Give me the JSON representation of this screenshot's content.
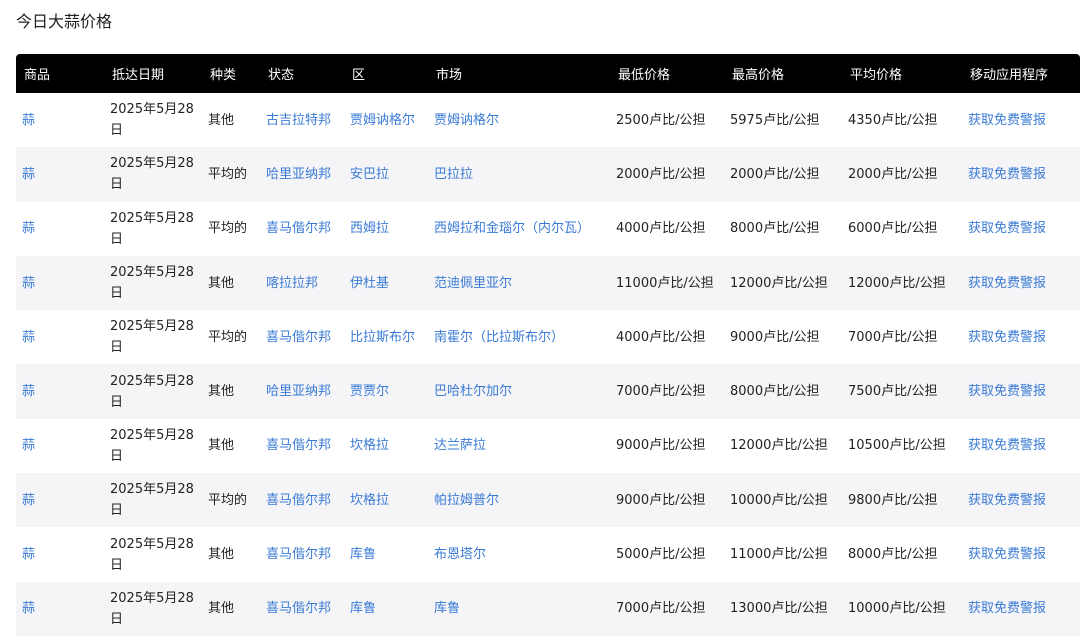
{
  "page": {
    "title": "今日大蒜价格"
  },
  "table": {
    "headers": [
      "商品",
      "抵达日期",
      "种类",
      "状态",
      "区",
      "市场",
      "最低价格",
      "最高价格",
      "平均价格",
      "移动应用程序"
    ],
    "rows": [
      {
        "product": "蒜",
        "date": "2025年5月28日",
        "variety": "其他",
        "state": "古吉拉特邦",
        "district": "贾姆讷格尔",
        "market": "贾姆讷格尔",
        "min": "2500卢比/公担",
        "max": "5975卢比/公担",
        "avg": "4350卢比/公担",
        "app": "获取免费警报"
      },
      {
        "product": "蒜",
        "date": "2025年5月28日",
        "variety": "平均的",
        "state": "哈里亚纳邦",
        "district": "安巴拉",
        "market": "巴拉拉",
        "min": "2000卢比/公担",
        "max": "2000卢比/公担",
        "avg": "2000卢比/公担",
        "app": "获取免费警报"
      },
      {
        "product": "蒜",
        "date": "2025年5月28日",
        "variety": "平均的",
        "state": "喜马偕尔邦",
        "district": "西姆拉",
        "market": "西姆拉和金瑙尔（内尔瓦）",
        "min": "4000卢比/公担",
        "max": "8000卢比/公担",
        "avg": "6000卢比/公担",
        "app": "获取免费警报"
      },
      {
        "product": "蒜",
        "date": "2025年5月28日",
        "variety": "其他",
        "state": "喀拉拉邦",
        "district": "伊杜基",
        "market": "范迪佩里亚尔",
        "min": "11000卢比/公担",
        "max": "12000卢比/公担",
        "avg": "12000卢比/公担",
        "app": "获取免费警报"
      },
      {
        "product": "蒜",
        "date": "2025年5月28日",
        "variety": "平均的",
        "state": "喜马偕尔邦",
        "district": "比拉斯布尔",
        "market": "南霍尔（比拉斯布尔）",
        "min": "4000卢比/公担",
        "max": "9000卢比/公担",
        "avg": "7000卢比/公担",
        "app": "获取免费警报"
      },
      {
        "product": "蒜",
        "date": "2025年5月28日",
        "variety": "其他",
        "state": "哈里亚纳邦",
        "district": "贾贾尔",
        "market": "巴哈杜尔加尔",
        "min": "7000卢比/公担",
        "max": "8000卢比/公担",
        "avg": "7500卢比/公担",
        "app": "获取免费警报"
      },
      {
        "product": "蒜",
        "date": "2025年5月28日",
        "variety": "其他",
        "state": "喜马偕尔邦",
        "district": "坎格拉",
        "market": "达兰萨拉",
        "min": "9000卢比/公担",
        "max": "12000卢比/公担",
        "avg": "10500卢比/公担",
        "app": "获取免费警报"
      },
      {
        "product": "蒜",
        "date": "2025年5月28日",
        "variety": "平均的",
        "state": "喜马偕尔邦",
        "district": "坎格拉",
        "market": "帕拉姆普尔",
        "min": "9000卢比/公担",
        "max": "10000卢比/公担",
        "avg": "9800卢比/公担",
        "app": "获取免费警报"
      },
      {
        "product": "蒜",
        "date": "2025年5月28日",
        "variety": "其他",
        "state": "喜马偕尔邦",
        "district": "库鲁",
        "market": "布恩塔尔",
        "min": "5000卢比/公担",
        "max": "11000卢比/公担",
        "avg": "8000卢比/公担",
        "app": "获取免费警报"
      },
      {
        "product": "蒜",
        "date": "2025年5月28日",
        "variety": "其他",
        "state": "喜马偕尔邦",
        "district": "库鲁",
        "market": "库鲁",
        "min": "7000卢比/公担",
        "max": "13000卢比/公担",
        "avg": "10000卢比/公担",
        "app": "获取免费警报"
      }
    ]
  }
}
